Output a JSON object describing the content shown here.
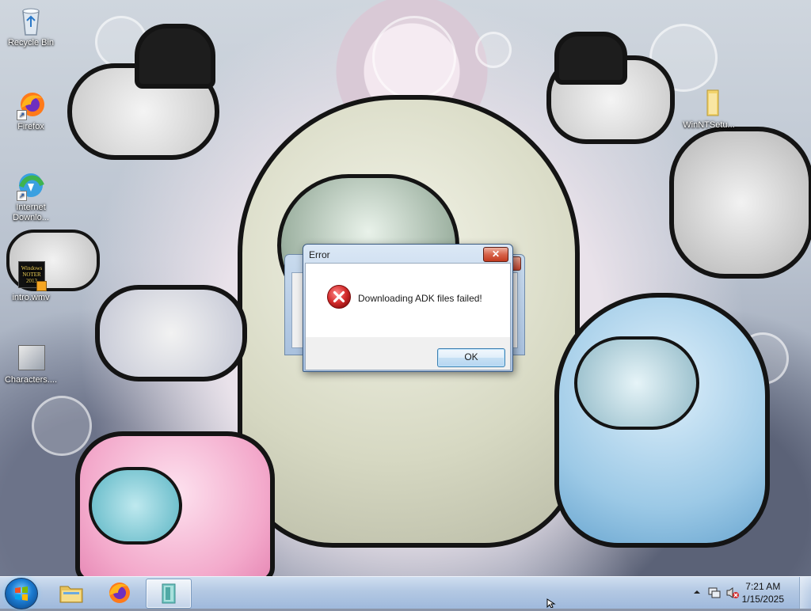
{
  "desktop": {
    "icons": [
      {
        "label": "Recycle Bin"
      },
      {
        "label": "Firefox"
      },
      {
        "label": "Internet Downlo..."
      },
      {
        "label": "intro.wmv"
      },
      {
        "label": "Characters...."
      },
      {
        "label": "WinNTSetu..."
      }
    ],
    "thumbnail_text": "Windows NOTER 2013"
  },
  "error_dialog": {
    "title": "Error",
    "close_glyph": "✕",
    "message": "Downloading ADK files failed!",
    "ok_label": "OK",
    "icon": "error-icon"
  },
  "back_dialog": {
    "close_glyph": "✕"
  },
  "taskbar": {
    "pinned": [
      "windows-explorer-icon",
      "firefox-icon",
      "app-icon"
    ],
    "clock": {
      "time": "7:21 AM",
      "date": "1/15/2025"
    },
    "tray_icons": [
      "show-hidden-icons-chevron",
      "network-icon",
      "volume-muted-icon"
    ]
  },
  "colors": {
    "dialog_frame": "#b8cde6",
    "error_red": "#c4161c",
    "ok_border": "#3c7fb1",
    "taskbar": "#b3c8e3"
  }
}
